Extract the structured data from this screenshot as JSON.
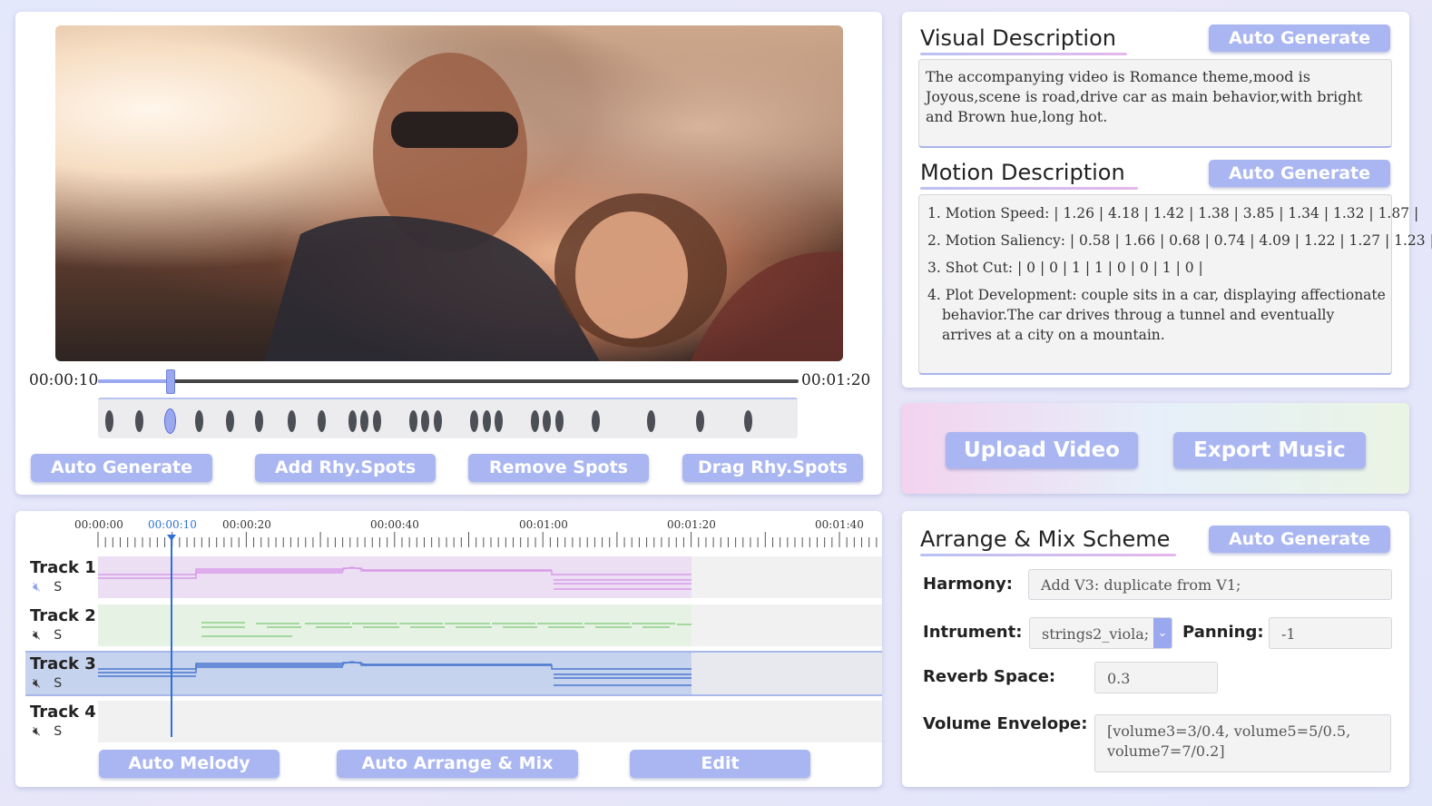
{
  "video": {
    "current_time": "00:00:10",
    "total_time": "00:01:20",
    "progress": 0.103
  },
  "rhythm": {
    "spots": [
      {
        "x": 0.01
      },
      {
        "x": 0.055
      },
      {
        "x": 0.101,
        "selected": true
      },
      {
        "x": 0.144
      },
      {
        "x": 0.189
      },
      {
        "x": 0.233
      },
      {
        "x": 0.281
      },
      {
        "x": 0.326
      },
      {
        "x": 0.372
      },
      {
        "x": 0.39
      },
      {
        "x": 0.408
      },
      {
        "x": 0.462
      },
      {
        "x": 0.48
      },
      {
        "x": 0.499
      },
      {
        "x": 0.553
      },
      {
        "x": 0.571
      },
      {
        "x": 0.589
      },
      {
        "x": 0.643
      },
      {
        "x": 0.661
      },
      {
        "x": 0.68
      },
      {
        "x": 0.734
      },
      {
        "x": 0.816
      },
      {
        "x": 0.888
      },
      {
        "x": 0.96
      }
    ]
  },
  "video_buttons": {
    "auto_generate": "Auto Generate",
    "add_spots": "Add Rhy.Spots",
    "remove_spots": "Remove Spots",
    "drag_spots": "Drag Rhy.Spots"
  },
  "timeline": {
    "ticks": [
      "00:00:00",
      "00:00:10",
      "00:00:20",
      "00:00:40",
      "00:01:00",
      "00:01:20",
      "00:01:40"
    ],
    "playhead_label": "00:00:10",
    "tracks": [
      {
        "name": "Track 1",
        "mute_icon": "mute-icon",
        "solo": "S",
        "color": "#ecdff4"
      },
      {
        "name": "Track 2",
        "mute_icon": "mute-icon",
        "solo": "S",
        "color": "#e6f2e4"
      },
      {
        "name": "Track 3",
        "mute_icon": "mute-icon",
        "solo": "S",
        "color": "#c6d3ee"
      },
      {
        "name": "Track 4",
        "mute_icon": "mute-icon",
        "solo": "S",
        "color": "#f1f1f2"
      }
    ],
    "buttons": {
      "auto_melody": "Auto Melody",
      "auto_arrange": "Auto Arrange & Mix",
      "edit": "Edit"
    }
  },
  "visual": {
    "title": "Visual Description",
    "auto_generate": "Auto Generate",
    "text": "The accompanying video is Romance theme,mood is Joyous,scene is road,drive car as main behavior,with bright and Brown hue,long hot."
  },
  "motion": {
    "title": "Motion Description",
    "auto_generate": "Auto Generate",
    "items": [
      "1. Motion Speed: | 1.26 | 4.18 | 1.42 | 1.38 | 3.85 | 1.34 | 1.32 | 1.87 |",
      "2. Motion Saliency: | 0.58 | 1.66 | 0.68 | 0.74 | 4.09 | 1.22 | 1.27 | 1.23 |",
      "3. Shot Cut: | 0 | 0 | 1 | 1 | 0 | 0 | 1 | 0 |",
      "4. Plot Development: couple sits in a car, displaying affectionate behavior.The car drives throug a tunnel and eventually arrives at a city on a mountain."
    ]
  },
  "actions": {
    "upload": "Upload Video",
    "export": "Export Music"
  },
  "arrange": {
    "title": "Arrange & Mix Scheme",
    "auto_generate": "Auto Generate",
    "harmony_label": "Harmony:",
    "harmony_value": "Add V3: duplicate from V1;",
    "instrument_label": "Intrument:",
    "instrument_value": "strings2_viola;",
    "panning_label": "Panning:",
    "panning_value": "-1",
    "reverb_label": "Reverb Space:",
    "reverb_value": "0.3",
    "volume_label": "Volume Envelope:",
    "volume_value": "[volume3=3/0.4, volume5=5/0.5, volume7=7/0.2]"
  },
  "colors": {
    "accent": "#aab6f2",
    "playhead": "#2f6fd8",
    "track1_notes": "#d89be6",
    "track2_notes": "#8fcf8a",
    "track3_notes": "#4a78d0"
  }
}
